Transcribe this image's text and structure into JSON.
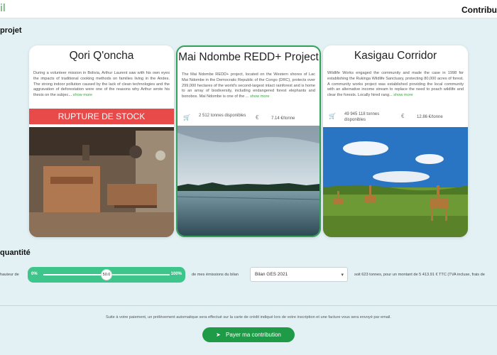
{
  "header": {
    "logo": "il",
    "title": "Contribu"
  },
  "sections": {
    "project": "projet",
    "quantity": "quantité"
  },
  "projects": [
    {
      "title": "Qori Q'oncha",
      "description": "During a volunteer mission in Bolivia, Arthur Laurent saw with his own eyes the impacts of traditional cooking methods on families living in the Andes. The strong indoor pollution caused by the lack of clean technologies and the aggravation of deforestation were one of the reasons why Arthur wrote his thesis on the subjec...",
      "show_more": "show more",
      "badge": "RUPTURE DE STOCK"
    },
    {
      "title": "Mai Ndombe REDD+ Project",
      "description": "The Mai Ndombe REDD+ project, located on the Western shores of Lac Mai Ndombe in the Democratic Republic of the Congo (DRC), protects over 299,000 hectares of the world's second-largest intact rainforest and is home to an array of biodiversity, including endangered forest elephants and bonobos. Mai Ndombe is one of the ...",
      "show_more": "show more",
      "stock": "2 512 tonnes disponibles",
      "price": "7.14 €/tonne"
    },
    {
      "title": "Kasigau Corridor",
      "description": "Wildlife Works engaged the community and made the case in 1998 for establishing the Rukinga Wildlife Sanctuary, protecting 80,000 acres of forest. A community works project was established providing the local community with an alternative income stream to replace the need to poach wildlife and clear the forests. Locally hired rang...",
      "show_more": "show more",
      "stock": "49 945 118 tonnes disponibles",
      "price": "12.86 €/tonne"
    }
  ],
  "quantity": {
    "prefix": "hauteur de",
    "slider_min": "0%",
    "slider_max": "100%",
    "slider_value": "50.0",
    "slider_fraction": 0.5,
    "middle_text": "de mes émissions du bilan",
    "select_value": "Bilan GES 2021",
    "result": "soit 623 tonnes, pour un montant de 5 413.91 € TTC (TVA incluse, frais de"
  },
  "footer": {
    "note": "Suite à votre paiement, un prélèvement automatique sera effectué sur la carte de crédit indiqué lors de votre inscription et une facture vous sera envoyé par email.",
    "pay_button": "Payer ma contribution"
  },
  "icons": {
    "cart": "cart-icon",
    "euro": "euro-icon",
    "caret": "chevron-down-icon",
    "send": "send-icon"
  },
  "colors": {
    "accent": "#3ec58b",
    "pay": "#1f9b47",
    "rupture": "#e84a4a",
    "logo": "#3aa344"
  }
}
